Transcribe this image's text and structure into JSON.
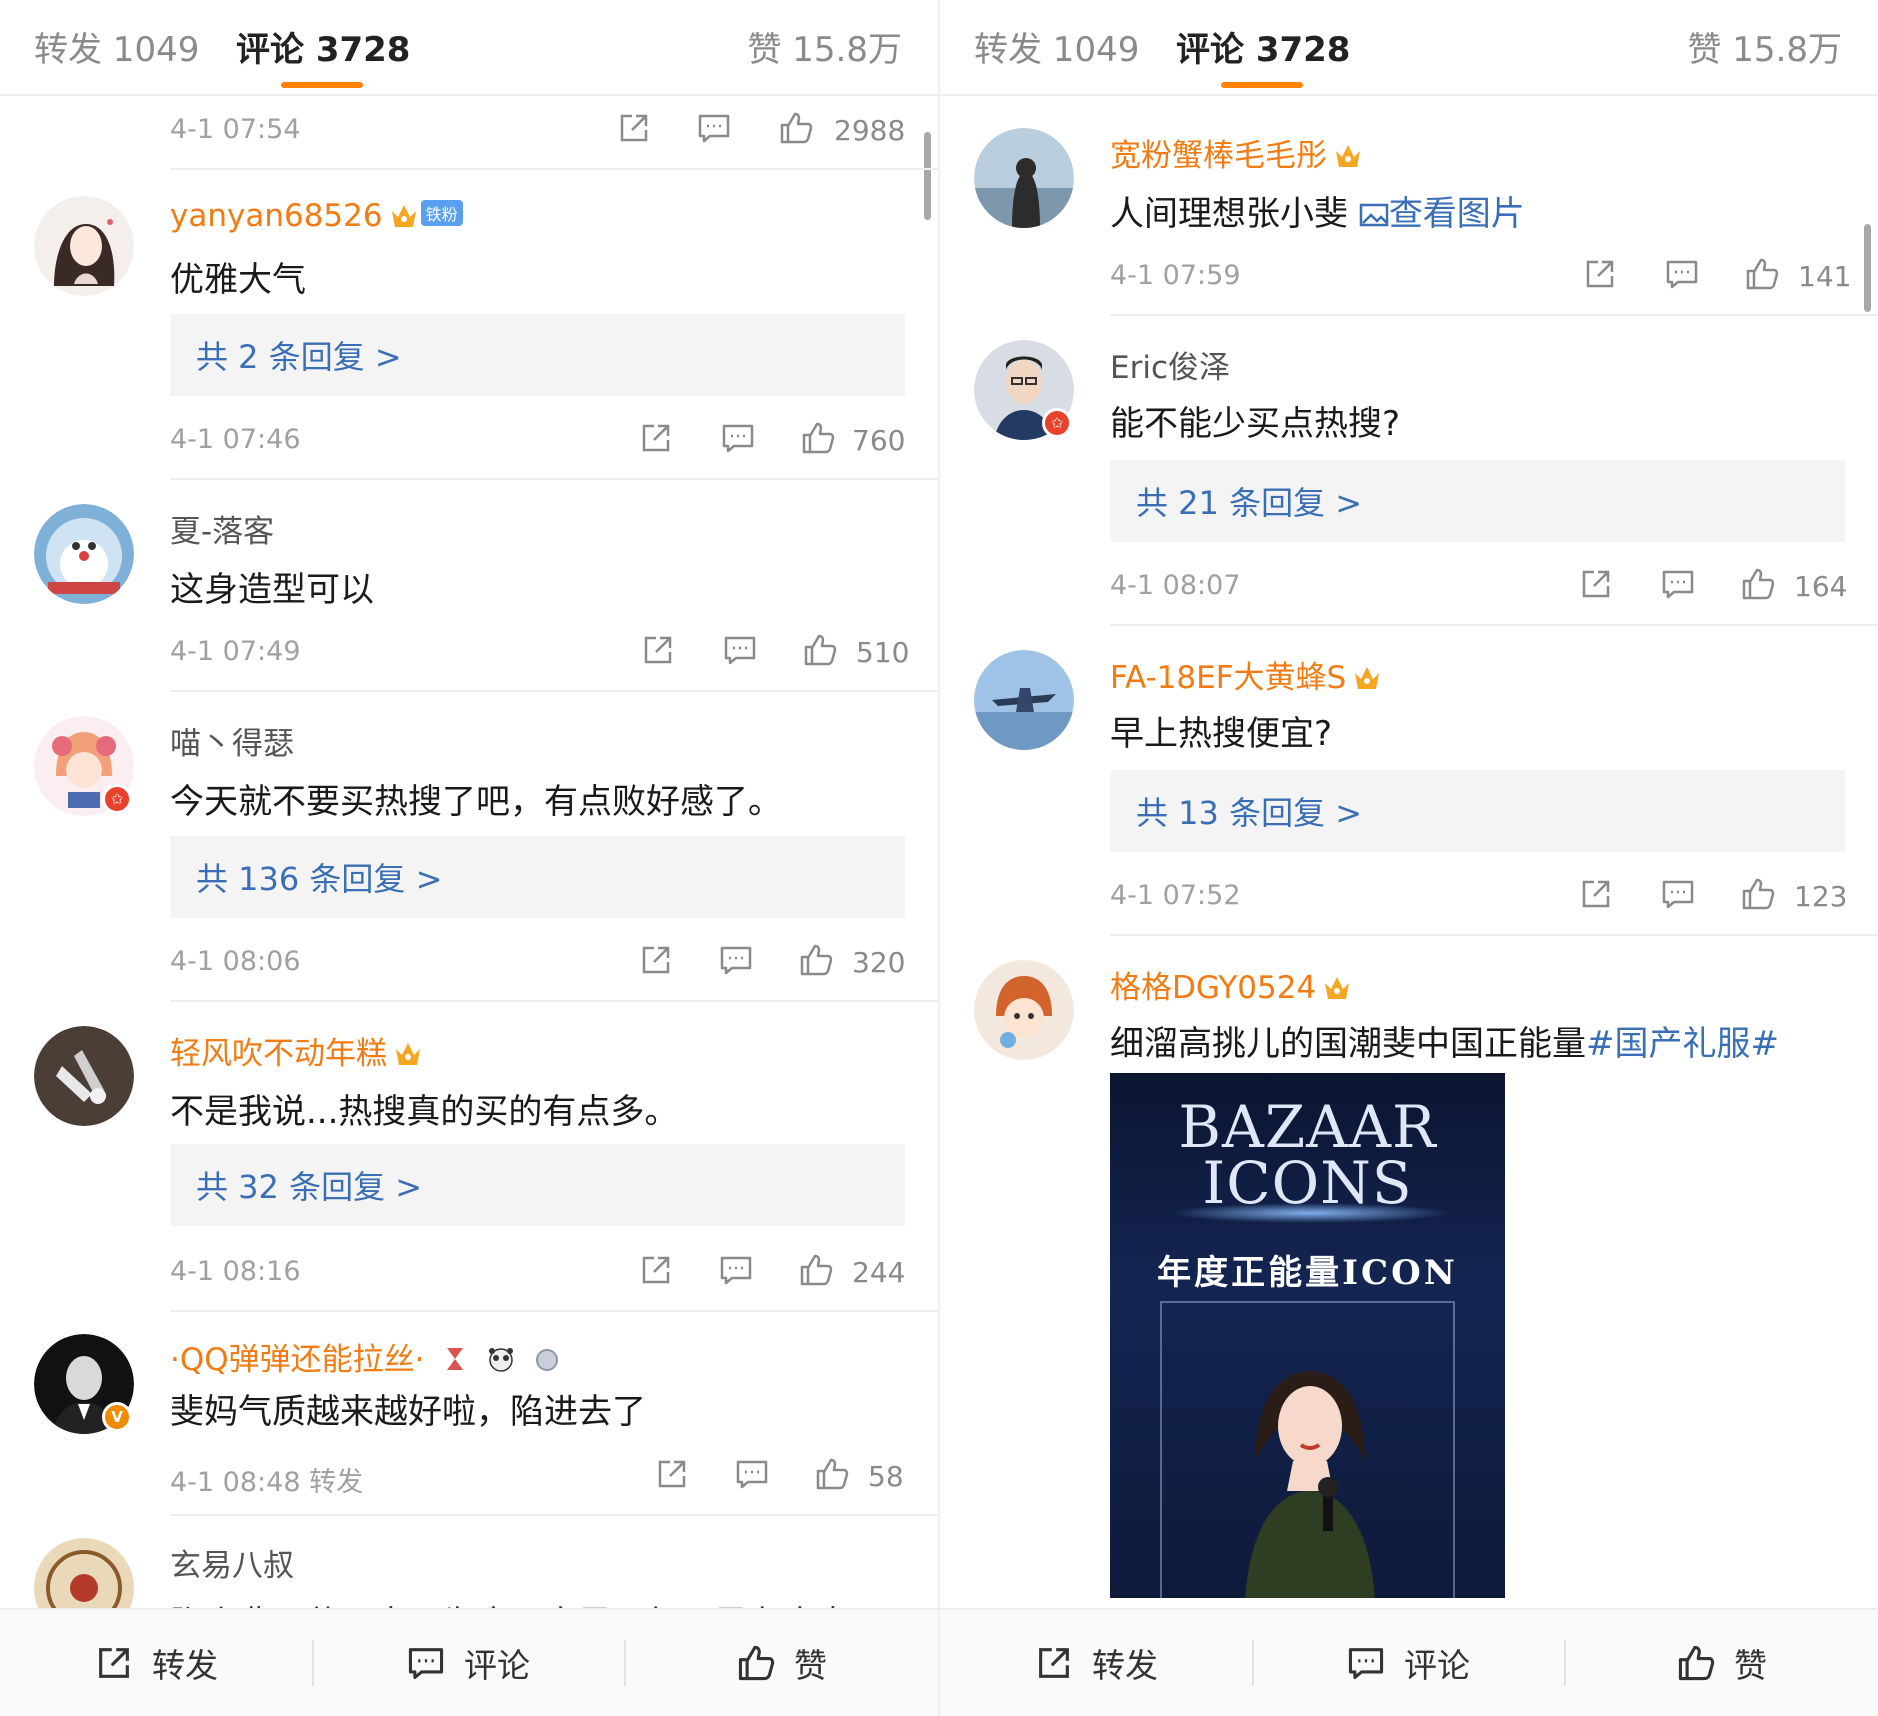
{
  "tabs": {
    "repost": "转发 1049",
    "comments": "评论 3728",
    "likes": "赞 15.8万"
  },
  "left": {
    "top_meta": {
      "time": "4-1 07:54",
      "likes": "2988"
    },
    "comments": [
      {
        "name": "yanyan68526",
        "fan_badge": "铁粉",
        "text": "优雅大气",
        "replies": "共 2 条回复 >",
        "time": "4-1 07:46",
        "likes": "760"
      },
      {
        "name": "夏-落客",
        "text": "这身造型可以",
        "time": "4-1 07:49",
        "likes": "510"
      },
      {
        "name": "喵丶得瑟",
        "text": "今天就不要买热搜了吧，有点败好感了。",
        "replies": "共 136 条回复 >",
        "time": "4-1 08:06",
        "likes": "320"
      },
      {
        "name": "轻风吹不动年糕",
        "text": "不是我说...热搜真的买的有点多。",
        "replies": "共 32 条回复 >",
        "time": "4-1 08:16",
        "likes": "244"
      },
      {
        "name": "·QQ弹弹还能拉丝·",
        "text": "斐妈气质越来越好啦，陷进去了",
        "time": "4-1 08:48 转发",
        "likes": "58"
      },
      {
        "name": "玄易八叔",
        "text": "张小斐一什不幸只为命匹宁早一复不早有度走"
      }
    ]
  },
  "right": {
    "comments": [
      {
        "name": "宽粉蟹棒毛毛彤",
        "text": "人间理想张小斐",
        "link": "查看图片",
        "time": "4-1 07:59",
        "likes": "141"
      },
      {
        "name": "Eric俊泽",
        "text": "能不能少买点热搜?",
        "replies": "共 21 条回复 >",
        "time": "4-1 08:07",
        "likes": "164"
      },
      {
        "name": "FA-18EF大黄蜂S",
        "text": "早上热搜便宜?",
        "replies": "共 13 条回复 >",
        "time": "4-1 07:52",
        "likes": "123"
      },
      {
        "name": "格格DGY0524",
        "text": "细溜高挑儿的国潮斐中国正能量",
        "tag": "#国产礼服#"
      }
    ],
    "image": {
      "title_line1": "BAZAAR",
      "title_line2": "ICONS",
      "subtitle": "年度正能量ICON"
    }
  },
  "bottombar": {
    "repost": "转发",
    "comment": "评论",
    "like": "赞"
  },
  "colors": {
    "accent": "#ff8200",
    "link": "#3a6fb5",
    "vip_name": "#f07c13",
    "muted": "#a0a0a0"
  },
  "icons": [
    "share-icon",
    "comment-icon",
    "like-icon",
    "crown-icon",
    "verified-badge-icon",
    "image-icon"
  ]
}
